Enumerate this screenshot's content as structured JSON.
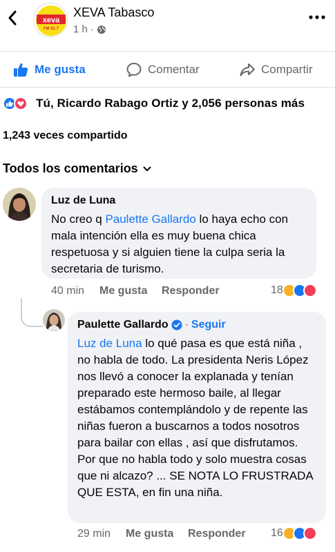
{
  "header": {
    "page_name": "XEVA Tabasco",
    "time_ago": "1 h",
    "logo_text": "xeva",
    "logo_freq": "FM 91.7"
  },
  "actions": {
    "like": "Me gusta",
    "comment": "Comentar",
    "share": "Compartir"
  },
  "reactions": {
    "summary": "Tú, Ricardo Rabago Ortiz y 2,056 personas más"
  },
  "shares": "1,243 veces compartido",
  "comments_filter": "Todos los comentarios",
  "comments": [
    {
      "author": "Luz de Luna",
      "text_before": "No creo q ",
      "mention": "Paulette Gallardo",
      "text_after": " lo haya echo con mala intención ella es muy buena chica respetuosa y si alguien tiene la culpa seria la secretaria de turismo.",
      "time": "40 min",
      "like_label": "Me gusta",
      "reply_label": "Responder",
      "reaction_count": "18"
    },
    {
      "author": "Paulette Gallardo",
      "verified": true,
      "follow_label": "Seguir",
      "mention": "Luz de Luna",
      "text_after": " lo qué pasa es que está niña , no habla de todo. La presidenta Neris López nos llevó a conocer la explanada y tenían preparado este hermoso baile, al llegar estábamos contemplándolo y de repente las niñas fueron a buscarnos a todos nosotros para bailar con ellas , así que disfrutamos. Por que no habla todo y solo muestra cosas que ni alcazo? ... SE NOTA LO FRUSTRADA QUE ESTA, en fin una niña.",
      "time": "29 min",
      "like_label": "Me gusta",
      "reply_label": "Responder",
      "reaction_count": "16"
    }
  ],
  "colors": {
    "accent": "#1877f2",
    "muted": "#65676b",
    "bubble": "#f0f2f5",
    "love": "#f33e58",
    "haha": "#f7b125"
  }
}
